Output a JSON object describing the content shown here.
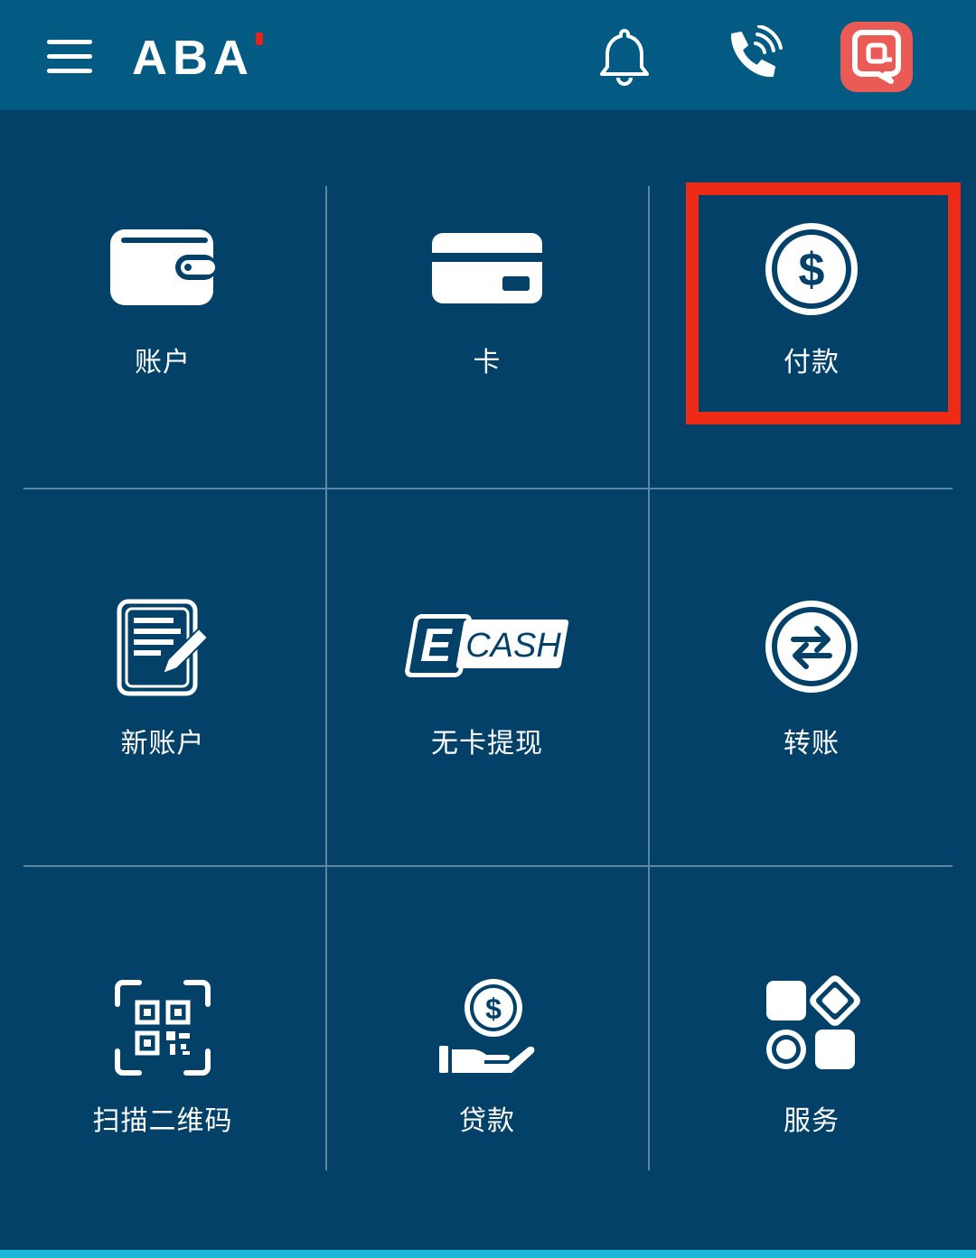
{
  "header": {
    "logo_text": "ABA",
    "menu_icon": "hamburger-menu-icon",
    "notification_icon": "bell-icon",
    "call_icon": "phone-call-icon",
    "chat_icon": "chat-at-icon",
    "chat_color": "#ea5b55",
    "bar_color": "#035a82"
  },
  "tiles": [
    {
      "label": "账户",
      "icon": "wallet-icon"
    },
    {
      "label": "卡",
      "icon": "card-icon"
    },
    {
      "label": "付款",
      "icon": "dollar-coin-icon"
    },
    {
      "label": "新账户",
      "icon": "new-account-form-icon"
    },
    {
      "label": "无卡提现",
      "icon": "ecash-icon",
      "icon_text": "CASH",
      "icon_letter": "E"
    },
    {
      "label": "转账",
      "icon": "transfer-arrows-icon"
    },
    {
      "label": "扫描二维码",
      "icon": "qr-scan-icon"
    },
    {
      "label": "贷款",
      "icon": "loan-hand-coin-icon"
    },
    {
      "label": "服务",
      "icon": "services-grid-icon"
    }
  ],
  "colors": {
    "background": "#034168",
    "highlight": "#ee2b16",
    "accent_bar": "#1ab8d6",
    "logo_mark": "#e2231a"
  }
}
